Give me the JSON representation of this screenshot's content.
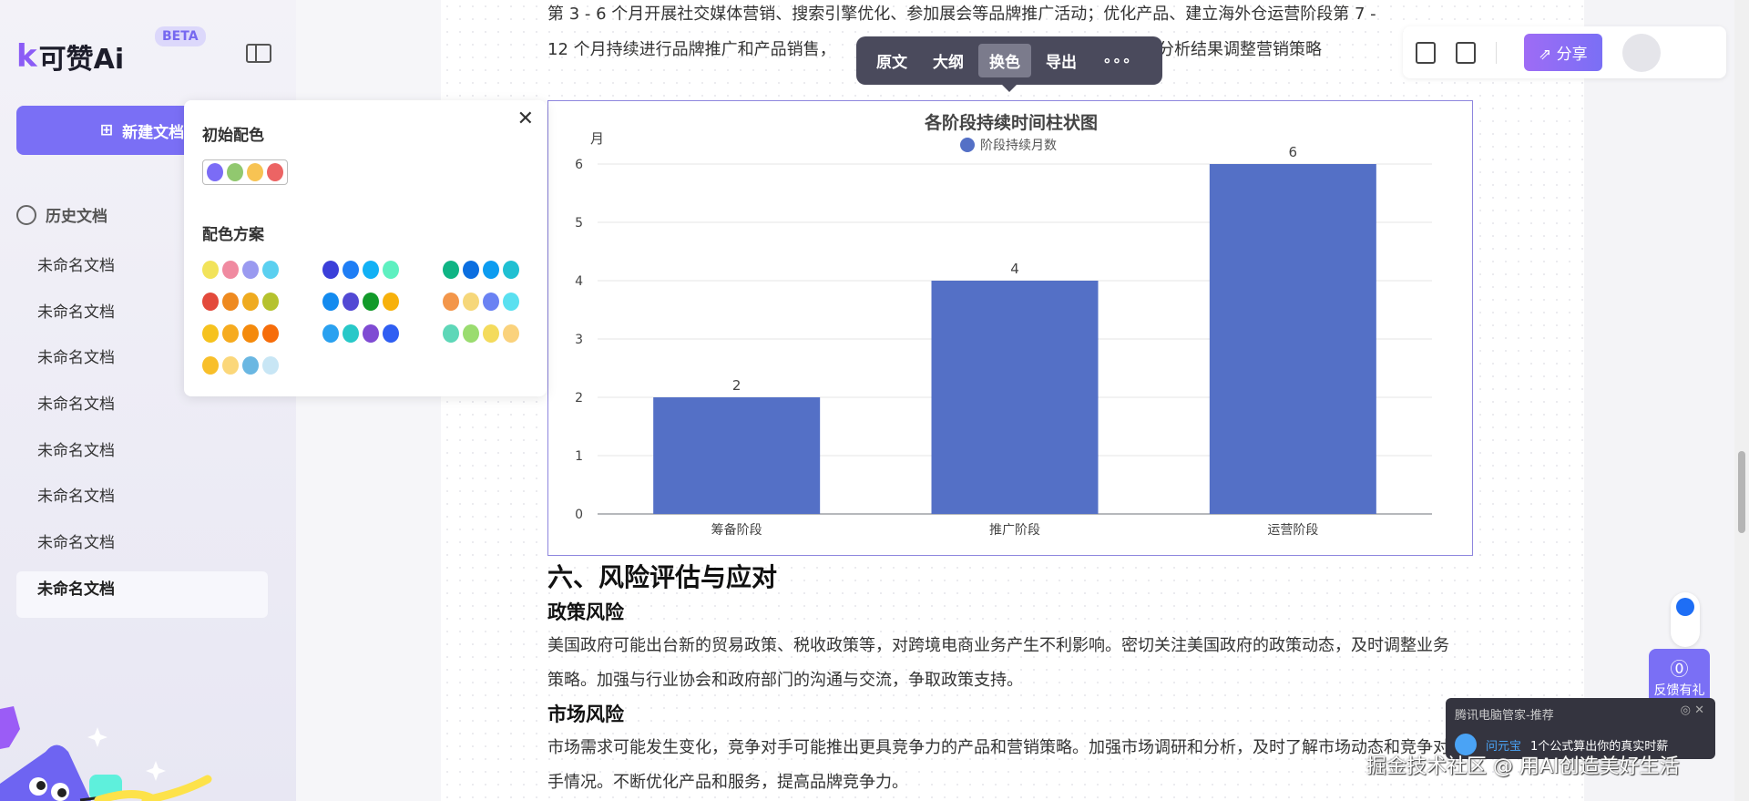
{
  "sidebar": {
    "logo": "可赞Ai",
    "beta": "BETA",
    "new_doc": "新建文档",
    "history": "历史文档",
    "items": [
      "未命名文档",
      "未命名文档",
      "未命名文档",
      "未命名文档",
      "未命名文档",
      "未命名文档",
      "未命名文档",
      "未命名文档"
    ]
  },
  "doc": {
    "line1": "第 3 - 6 个月开展社交媒体营销、搜索引擎优化、参加展会等品牌推广活动；优化产品、建立海外仓运营阶段第 7 -",
    "line2a": "12 个月持续进行品牌推广和产品销售，",
    "line2b": "分析结果调整营销策略",
    "h6": "六、风险评估与应对",
    "policy": "政策风险",
    "policy_p": "美国政府可能出台新的贸易政策、税收政策等，对跨境电商业务产生不利影响。密切关注美国政府的政策动态，及时调整业务策略。加强与行业协会和政府部门的沟通与交流，争取政策支持。",
    "market": "市场风险",
    "market_p": "市场需求可能发生变化，竞争对手可能推出更具竞争力的产品和营销策略。加强市场调研和分析，及时了解市场动态和竞争对手情况。不断优化产品和服务，提高品牌竞争力。"
  },
  "toolbar": {
    "items": [
      "原文",
      "大纲",
      "换色",
      "导出",
      "∘∘∘"
    ],
    "active": "换色"
  },
  "topright": {
    "share": "分享"
  },
  "popup": {
    "initial_title": "初始配色",
    "initial": [
      "#7b6cf6",
      "#91c86f",
      "#f7c353",
      "#ec6464"
    ],
    "scheme_title": "配色方案",
    "schemes": [
      [
        [
          "#f2e35a",
          "#f08aa0",
          "#9a9af0",
          "#5bd0f0"
        ],
        [
          "#e34a3c",
          "#ee8a20",
          "#efab20",
          "#b5c22e"
        ],
        [
          "#f6c21e",
          "#f6ab1f",
          "#f48a0c",
          "#f66d0a"
        ],
        [
          "#f8bf2a",
          "#fbd77a",
          "#6ab7e2",
          "#c8e6f5"
        ]
      ],
      [
        [
          "#3b3fd9",
          "#1f7ef5",
          "#12b1f5",
          "#5ef0c0"
        ],
        [
          "#148bef",
          "#5249d4",
          "#129a2a",
          "#f7b10c"
        ],
        [
          "#2aa1f0",
          "#28c8c8",
          "#7f4bd3",
          "#2f5ef2"
        ]
      ],
      [
        [
          "#0fb484",
          "#0b6ee0",
          "#0d9cf0",
          "#20c0d2"
        ],
        [
          "#f3964a",
          "#f6d77a",
          "#6a82f3",
          "#5ae0f0"
        ],
        [
          "#5ed7b8",
          "#9adc6f",
          "#f4db5c",
          "#fad27c"
        ]
      ]
    ]
  },
  "chart_data": {
    "type": "bar",
    "title": "各阶段持续时间柱状图",
    "legend": "阶段持续月数",
    "ylabel": "月",
    "xlabel": "",
    "categories": [
      "筹备阶段",
      "推广阶段",
      "运营阶段"
    ],
    "values": [
      2,
      4,
      6
    ],
    "ylim": [
      0,
      6
    ],
    "yticks": [
      0,
      1,
      2,
      3,
      4,
      5,
      6
    ],
    "color": "#5470c6",
    "grid": true,
    "legend_position": "top-center"
  },
  "tencent": {
    "title": "腾讯电脑管家-推荐",
    "brand": "问元宝",
    "message": "1个公式算出你的真实时薪"
  },
  "feedback": "反馈有礼",
  "watermark": "掘金技术社区 @ 用AI创造美好生活"
}
